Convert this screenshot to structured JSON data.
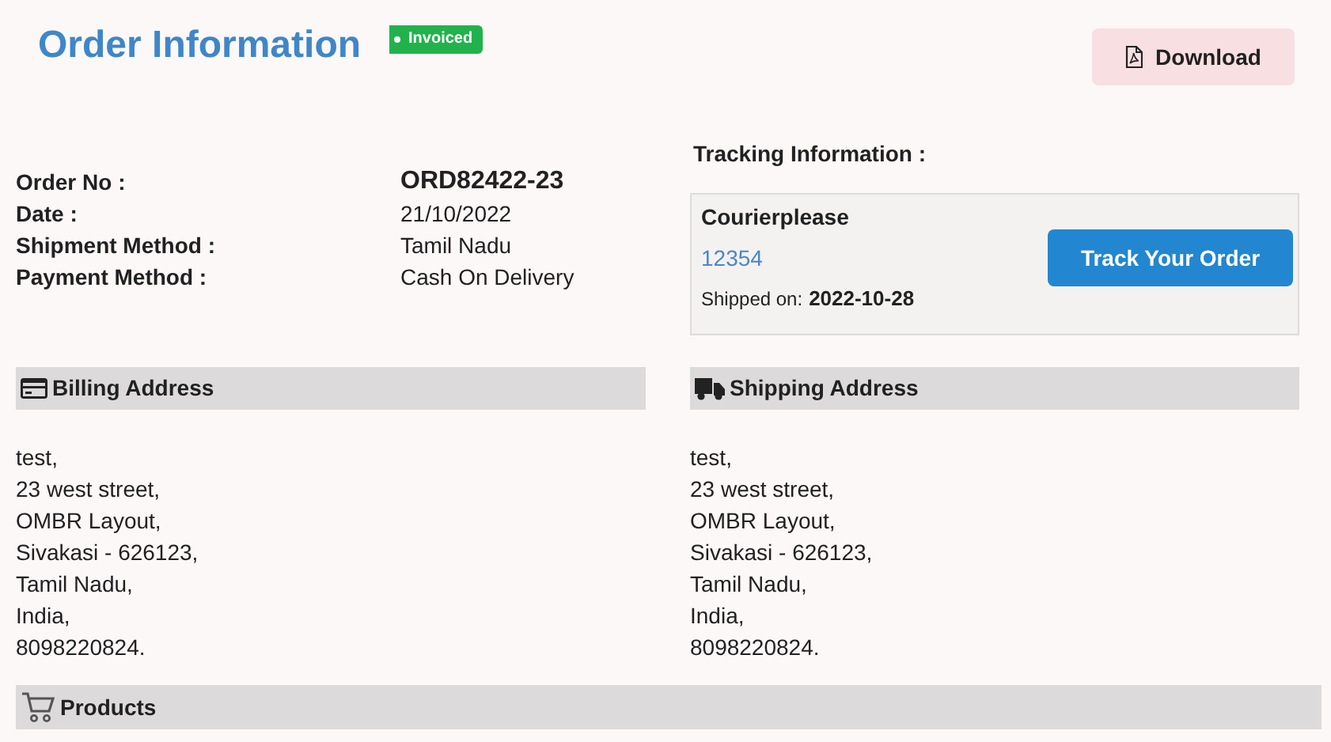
{
  "title": "Order Information",
  "status_badge": "Invoiced",
  "download_button": "Download",
  "order_details": [
    {
      "label": "Order No :",
      "value": "ORD82422-23",
      "kind": "emphasis"
    },
    {
      "label": "Date :",
      "value": "21/10/2022",
      "kind": "plain"
    },
    {
      "label": "Shipment Method :",
      "value": "Tamil Nadu",
      "kind": "plain"
    },
    {
      "label": "Payment Method :",
      "value": "Cash On Delivery",
      "kind": "plain"
    }
  ],
  "tracking": {
    "heading": "Tracking Information :",
    "courier": "Courierplease",
    "tracking_number": "12354",
    "shipped_label": "Shipped on:",
    "shipped_date": "2022-10-28",
    "button": "Track Your Order"
  },
  "billing": {
    "heading": "Billing Address",
    "lines": [
      "test,",
      "23 west street,",
      "OMBR Layout,",
      "Sivakasi - 626123,",
      "Tamil Nadu,",
      "India,",
      "8098220824."
    ]
  },
  "shipping": {
    "heading": "Shipping Address",
    "lines": [
      "test,",
      "23 west street,",
      "OMBR Layout,",
      "Sivakasi - 626123,",
      "Tamil Nadu,",
      "India,",
      "8098220824."
    ]
  },
  "products": {
    "heading": "Products"
  }
}
